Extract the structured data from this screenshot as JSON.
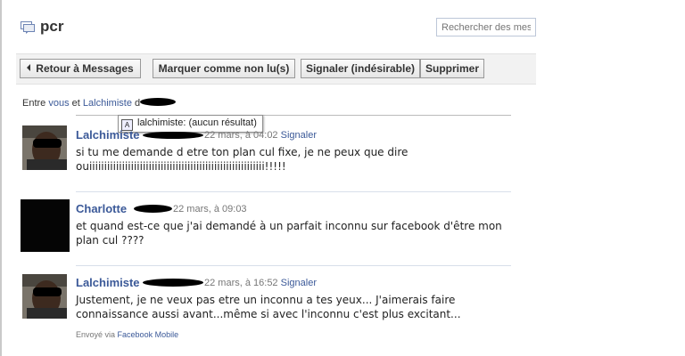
{
  "thread": {
    "title": "pcr",
    "search_placeholder": "Rechercher des messages"
  },
  "toolbar": {
    "back_label": "Retour à Messages",
    "mark_unread_label": "Marquer comme non lu(s)",
    "report_label": "Signaler (indésirable)",
    "delete_label": "Supprimer"
  },
  "participants": {
    "prefix": "Entre",
    "you": "vous",
    "conjunction": "et",
    "other": "Lalchimiste",
    "trailing": "d"
  },
  "tooltip": {
    "text": "lalchimiste: (aucun résultat)"
  },
  "messages": [
    {
      "author": "Lalchimiste",
      "time": "22 mars, à 04:02",
      "action": "Signaler",
      "body_lines": [
        "si tu me demande d etre ton plan cul fixe, je ne peux que dire",
        "ouiiiiiiiiiiiiiiiiiiiiiiiiiiiiiiiiiiiiiiiiiiiiiiiiiiiiiiiiiii!!!!!"
      ]
    },
    {
      "author": "Charlotte",
      "time": "22 mars, à 09:03",
      "body_lines": [
        "et quand est-ce que j'ai demandé à un parfait inconnu sur facebook d'être mon",
        "plan cul ????"
      ]
    },
    {
      "author": "Lalchimiste",
      "time": "22 mars, à 16:52",
      "action": "Signaler",
      "body_lines": [
        "Justement, je ne veux pas etre un inconnu a tes yeux... J'aimerais faire",
        "connaissance aussi avant...même si avec l'inconnu c'est plus excitant..."
      ],
      "via_prefix": "Envoyé via",
      "via_link": "Facebook Mobile"
    }
  ]
}
